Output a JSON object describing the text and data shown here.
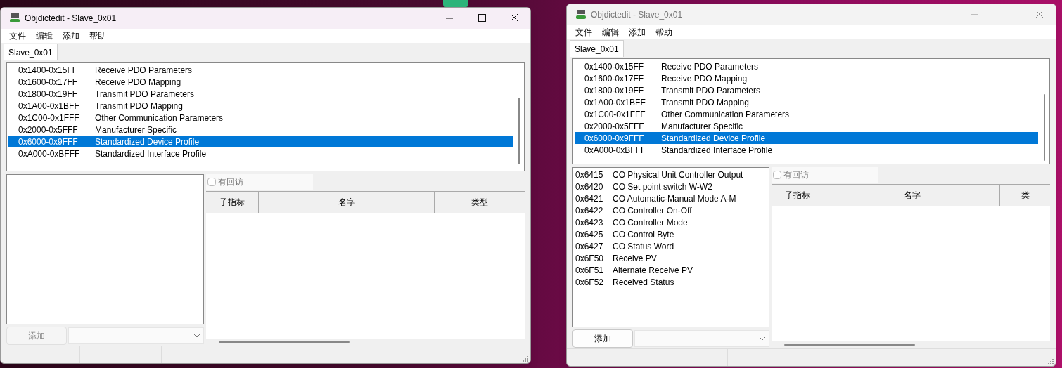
{
  "windows": [
    {
      "title": "Objdictedit - Slave_0x01",
      "active": true,
      "menu": [
        "文件",
        "编辑",
        "添加",
        "帮助"
      ],
      "tabs": [
        {
          "label": "Slave_0x01",
          "selected": true
        }
      ],
      "ranges": [
        {
          "range": "0x1400-0x15FF",
          "name": "Receive PDO Parameters",
          "selected": false
        },
        {
          "range": "0x1600-0x17FF",
          "name": "Receive PDO Mapping",
          "selected": false
        },
        {
          "range": "0x1800-0x19FF",
          "name": "Transmit PDO Parameters",
          "selected": false
        },
        {
          "range": "0x1A00-0x1BFF",
          "name": "Transmit PDO Mapping",
          "selected": false
        },
        {
          "range": "0x1C00-0x1FFF",
          "name": "Other Communication Parameters",
          "selected": false
        },
        {
          "range": "0x2000-0x5FFF",
          "name": "Manufacturer Specific",
          "selected": false
        },
        {
          "range": "0x6000-0x9FFF",
          "name": "Standardized Device Profile",
          "selected": true
        },
        {
          "range": "0xA000-0xBFFF",
          "name": "Standardized Interface Profile",
          "selected": false
        }
      ],
      "checkbox": {
        "label": "有回访",
        "checked": false
      },
      "columns": [
        "子指标",
        "名字",
        "类型"
      ],
      "add_button": {
        "label": "添加",
        "disabled": true
      }
    },
    {
      "title": "Objdictedit - Slave_0x01",
      "active": false,
      "menu": [
        "文件",
        "编辑",
        "添加",
        "帮助"
      ],
      "tabs": [
        {
          "label": "Slave_0x01",
          "selected": true
        }
      ],
      "ranges": [
        {
          "range": "0x1400-0x15FF",
          "name": "Receive PDO Parameters",
          "selected": false
        },
        {
          "range": "0x1600-0x17FF",
          "name": "Receive PDO Mapping",
          "selected": false
        },
        {
          "range": "0x1800-0x19FF",
          "name": "Transmit PDO Parameters",
          "selected": false
        },
        {
          "range": "0x1A00-0x1BFF",
          "name": "Transmit PDO Mapping",
          "selected": false
        },
        {
          "range": "0x1C00-0x1FFF",
          "name": "Other Communication Parameters",
          "selected": false
        },
        {
          "range": "0x2000-0x5FFF",
          "name": "Manufacturer Specific",
          "selected": false
        },
        {
          "range": "0x6000-0x9FFF",
          "name": "Standardized Device Profile",
          "selected": true
        },
        {
          "range": "0xA000-0xBFFF",
          "name": "Standardized Interface Profile",
          "selected": false
        }
      ],
      "indexes": [
        {
          "index": "0x6415",
          "name": "CO Physical Unit Controller Output"
        },
        {
          "index": "0x6420",
          "name": "CO Set point switch W-W2"
        },
        {
          "index": "0x6421",
          "name": "CO Automatic-Manual Mode A-M"
        },
        {
          "index": "0x6422",
          "name": "CO Controller On-Off"
        },
        {
          "index": "0x6423",
          "name": "CO Controller Mode"
        },
        {
          "index": "0x6425",
          "name": "CO Control Byte"
        },
        {
          "index": "0x6427",
          "name": "CO Status Word"
        },
        {
          "index": "0x6F50",
          "name": "Receive PV"
        },
        {
          "index": "0x6F51",
          "name": "Alternate Receive PV"
        },
        {
          "index": "0x6F52",
          "name": "Received Status"
        }
      ],
      "checkbox": {
        "label": "有回访",
        "checked": false
      },
      "columns": [
        "子指标",
        "名字",
        "类"
      ],
      "add_button": {
        "label": "添加",
        "disabled": false
      }
    }
  ]
}
